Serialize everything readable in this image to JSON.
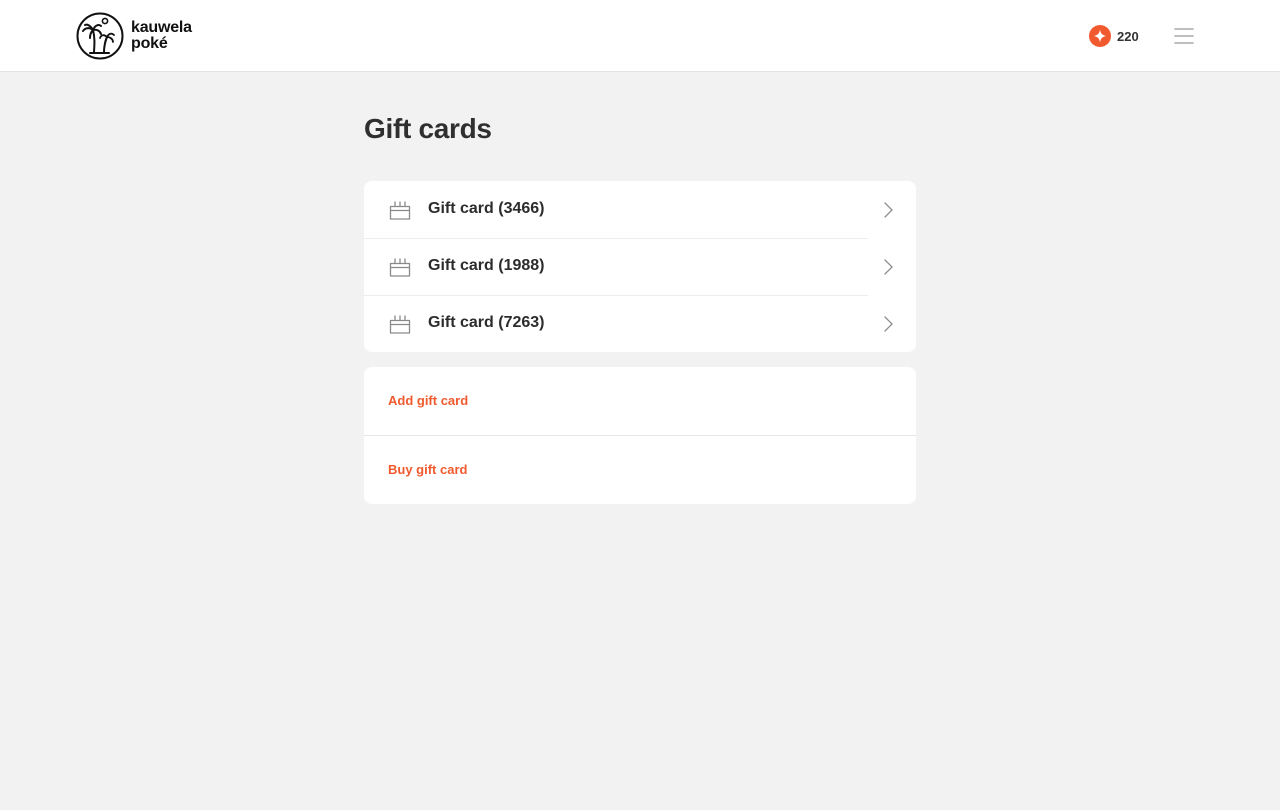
{
  "header": {
    "logo": {
      "line1": "kauwela",
      "line2": "poké",
      "icon": "palm-tree-logo-icon"
    },
    "points": {
      "value": "220",
      "icon": "sparkle-icon",
      "color": "#f15a2e"
    },
    "menu": {
      "icon": "hamburger-menu-icon"
    }
  },
  "main": {
    "title": "Gift cards",
    "cards": [
      {
        "label": "Gift card (3466)",
        "icon": "gift-icon"
      },
      {
        "label": "Gift card (1988)",
        "icon": "gift-icon"
      },
      {
        "label": "Gift card (7263)",
        "icon": "gift-icon"
      }
    ],
    "actions": {
      "add": "Add gift card",
      "buy": "Buy gift card"
    }
  },
  "colors": {
    "accent": "#f15a2e",
    "background": "#f2f2f2",
    "surface": "#ffffff",
    "text": "#2b2b2b"
  }
}
